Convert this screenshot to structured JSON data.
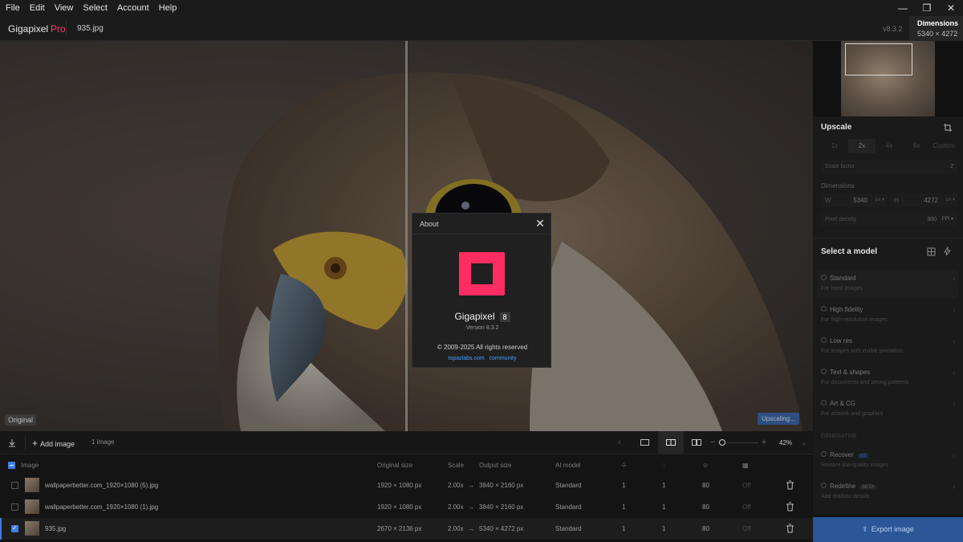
{
  "menu": [
    "File",
    "Edit",
    "View",
    "Select",
    "Account",
    "Help"
  ],
  "window_controls": {
    "minimize": "—",
    "restore": "❐",
    "close": "✕"
  },
  "titlebar": {
    "brand": "Gigapixel",
    "brand_tier": "Pro",
    "filename": "935.jpg",
    "version": "v8.3.2",
    "dimensions_title": "Dimensions",
    "dimensions_value": "5340 × 4272"
  },
  "canvas": {
    "original_badge": "Original",
    "upscaling_badge": "Upscaling..."
  },
  "about": {
    "title": "About",
    "app_name": "Gigapixel",
    "major_version": "8",
    "version": "Version 8.3.2",
    "copyright": "© 2009-2025 All rights reserved",
    "link_site": "topazlabs.com",
    "link_community": "community",
    "brand_color": "#ff2d61"
  },
  "upscale": {
    "title": "Upscale",
    "scales": [
      "1x",
      "2x",
      "4x",
      "6x",
      "Custom"
    ],
    "selected_scale": "2x",
    "scale_factor_label": "Scale factor",
    "scale_factor_value": "2",
    "dimensions_label": "Dimensions",
    "w_label": "W",
    "w_value": "5340",
    "w_unit": "px ▾",
    "h_label": "H",
    "h_value": "4272",
    "h_unit": "px ▾",
    "density_label": "Pixel density",
    "density_value": "300",
    "density_unit": "PPI ▾"
  },
  "models": {
    "title": "Select a model",
    "items": [
      {
        "name": "Standard",
        "desc": "For most images"
      },
      {
        "name": "High fidelity",
        "desc": "For high-resolution images"
      },
      {
        "name": "Low res",
        "desc": "For images with visible pixelation"
      },
      {
        "name": "Text & shapes",
        "desc": "For documents and strong patterns"
      },
      {
        "name": "Art & CG",
        "desc": "For artwork and graphics"
      }
    ],
    "generative_label": "GENERATIVE",
    "generative": [
      {
        "name": "Recover",
        "tag": "V2",
        "desc": "Restore low-quality images"
      },
      {
        "name": "Redefine",
        "tag": "BETA",
        "desc": "Add realistic details"
      }
    ]
  },
  "export_label": "Export image",
  "toolbar": {
    "add_image": "Add image",
    "image_count": "1 image",
    "zoom": "42%"
  },
  "table": {
    "headers": {
      "image": "Image",
      "original_size": "Original size",
      "scale": "Scale",
      "output_size": "Output size",
      "ai_model": "AI model"
    },
    "rows": [
      {
        "name": "wallpaperbetter.com_1920×1080 (5).jpg",
        "original": "1920 × 1080 px",
        "scale": "2.00x",
        "arrow": "→",
        "output": "3840 × 2160 px",
        "model": "Standard",
        "c1": "1",
        "c2": "1",
        "c3": "80",
        "c4": "Off",
        "checked": false
      },
      {
        "name": "wallpaperbetter.com_1920×1080 (1).jpg",
        "original": "1920 × 1080 px",
        "scale": "2.00x",
        "arrow": "→",
        "output": "3840 × 2160 px",
        "model": "Standard",
        "c1": "1",
        "c2": "1",
        "c3": "80",
        "c4": "Off",
        "checked": false
      },
      {
        "name": "935.jpg",
        "original": "2670 × 2136 px",
        "scale": "2.00x",
        "arrow": "→",
        "output": "5340 × 4272 px",
        "model": "Standard",
        "c1": "1",
        "c2": "1",
        "c3": "80",
        "c4": "Off",
        "checked": true
      }
    ]
  }
}
